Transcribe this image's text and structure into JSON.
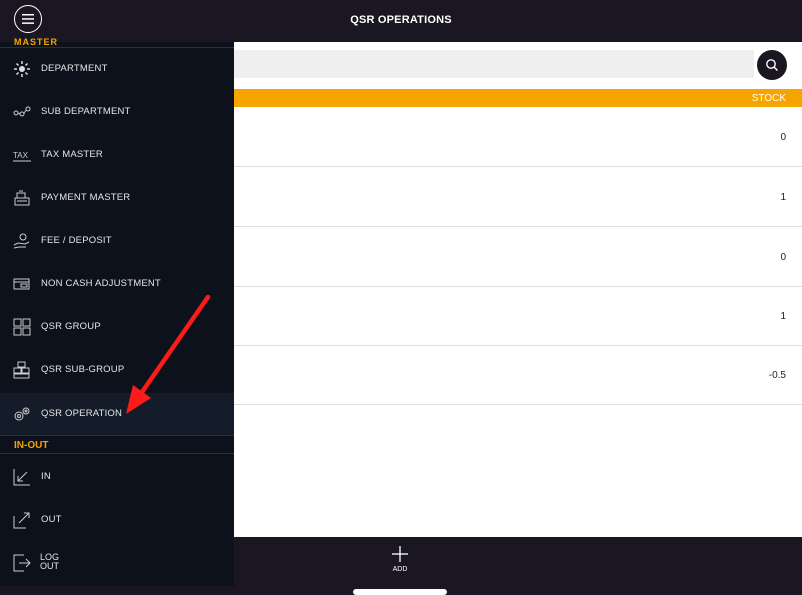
{
  "header": {
    "title": "QSR OPERATIONS"
  },
  "sidebar": {
    "partial_section": "MASTER",
    "items": [
      {
        "label": "DEPARTMENT"
      },
      {
        "label": "SUB DEPARTMENT"
      },
      {
        "label": "TAX MASTER",
        "icon_text": "TAX"
      },
      {
        "label": "PAYMENT MASTER"
      },
      {
        "label": "FEE / DEPOSIT"
      },
      {
        "label": "NON CASH ADJUSTMENT"
      },
      {
        "label": "QSR GROUP"
      },
      {
        "label": "QSR SUB-GROUP"
      },
      {
        "label": "QSR OPERATION"
      }
    ],
    "inout_section": "IN-OUT",
    "inout_items": [
      {
        "label": "IN"
      },
      {
        "label": "OUT"
      }
    ],
    "logout": {
      "line1": "LOG",
      "line2": "OUT"
    }
  },
  "table": {
    "header": "STOCK",
    "rows": [
      {
        "stock": "0"
      },
      {
        "stock": "1"
      },
      {
        "stock": "0"
      },
      {
        "stock": "1"
      },
      {
        "stock": "-0.5"
      }
    ]
  },
  "footer": {
    "add_label": "ADD"
  },
  "colors": {
    "accent": "#f5a400",
    "dark": "#1a1622",
    "sidebar": "#0c111b",
    "annotation": "#ff1a1a"
  }
}
